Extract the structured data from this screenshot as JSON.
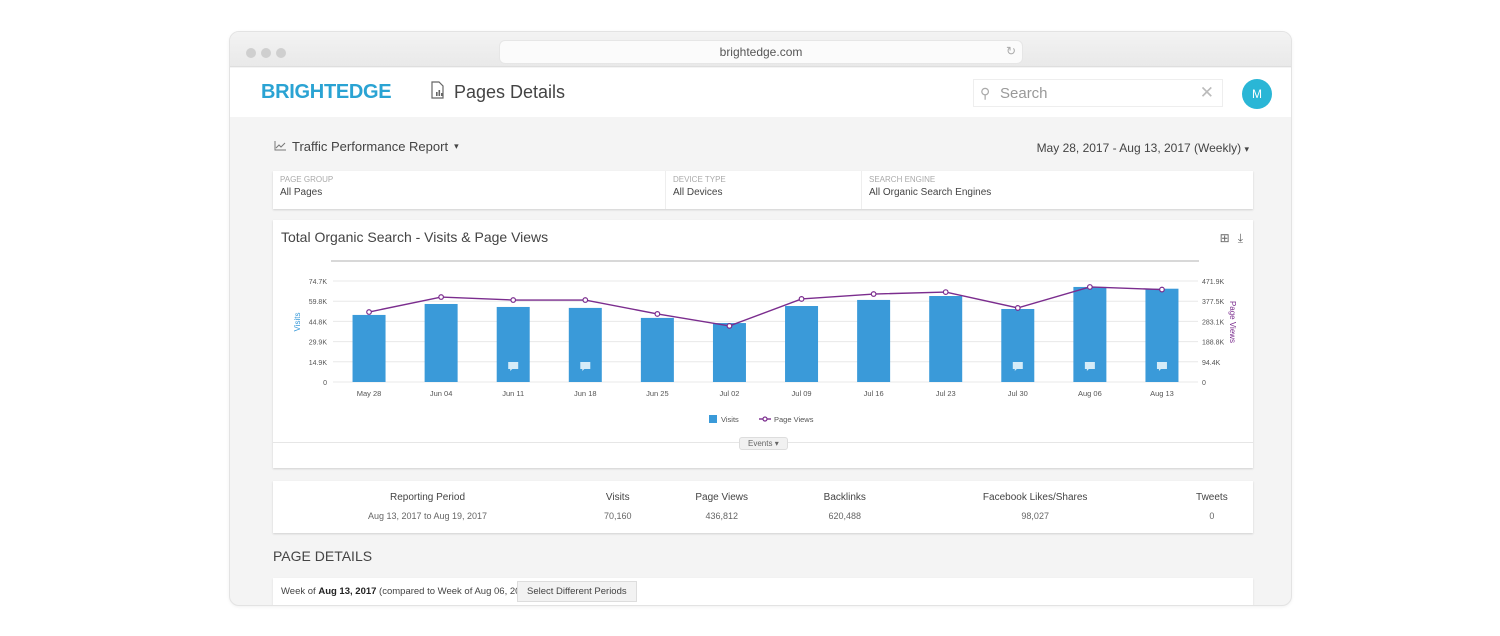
{
  "browser": {
    "url": "brightedge.com"
  },
  "app": {
    "logo": "BRIGHTEDGE",
    "page_title": "Pages Details",
    "search_placeholder": "Search",
    "avatar_initial": "M"
  },
  "report": {
    "title": "Traffic Performance Report",
    "date_range": "May 28, 2017 - Aug 13, 2017 (Weekly)"
  },
  "filters": [
    {
      "label": "PAGE GROUP",
      "value": "All Pages"
    },
    {
      "label": "DEVICE TYPE",
      "value": "All Devices"
    },
    {
      "label": "SEARCH ENGINE",
      "value": "All Organic Search Engines"
    }
  ],
  "events_label": "Events",
  "summary": {
    "headers": [
      "Reporting Period",
      "Visits",
      "Page Views",
      "Backlinks",
      "Facebook Likes/Shares",
      "Tweets"
    ],
    "row": [
      "Aug 13, 2017 to Aug 19, 2017",
      "70,160",
      "436,812",
      "620,488",
      "98,027",
      "0"
    ]
  },
  "page_details": {
    "title": "PAGE DETAILS",
    "week_prefix": "Week of ",
    "week_bold": "Aug 13, 2017",
    "week_suffix": " (compared to Week of Aug 06, 2017)",
    "select_button": "Select Different Periods"
  },
  "colors": {
    "visits": "#3a9ad9",
    "page_views": "#7b2d8e",
    "brand": "#2aa3d3"
  },
  "chart_data": {
    "type": "bar",
    "title": "Total Organic Search - Visits & Page Views",
    "categories": [
      "May 28",
      "Jun 04",
      "Jun 11",
      "Jun 18",
      "Jun 25",
      "Jul 02",
      "Jul 09",
      "Jul 16",
      "Jul 23",
      "Jul 30",
      "Aug 06",
      "Aug 13"
    ],
    "series": [
      {
        "name": "Visits",
        "type": "bar",
        "axis": "left",
        "values": [
          49600,
          57700,
          55500,
          54800,
          47400,
          43600,
          56200,
          60700,
          63600,
          54000,
          70300,
          69000
        ]
      },
      {
        "name": "Page Views",
        "type": "line",
        "axis": "right",
        "values": [
          327000,
          397000,
          383000,
          383000,
          318000,
          262000,
          388000,
          411000,
          420000,
          346000,
          444000,
          432000
        ]
      }
    ],
    "event_markers": [
      "Jun 11",
      "Jun 18",
      "Jul 30",
      "Aug 06",
      "Aug 13"
    ],
    "ylabel": "Visits",
    "ylabel_right": "Page Views",
    "ylim": [
      0,
      74700
    ],
    "ylim_right": [
      0,
      471900
    ],
    "yticks": [
      "0",
      "14.9K",
      "29.9K",
      "44.8K",
      "59.8K",
      "74.7K"
    ],
    "yticks_right": [
      "0",
      "94.4K",
      "188.8K",
      "283.1K",
      "377.5K",
      "471.9K"
    ],
    "grid": true,
    "legend": "bottom-center"
  }
}
